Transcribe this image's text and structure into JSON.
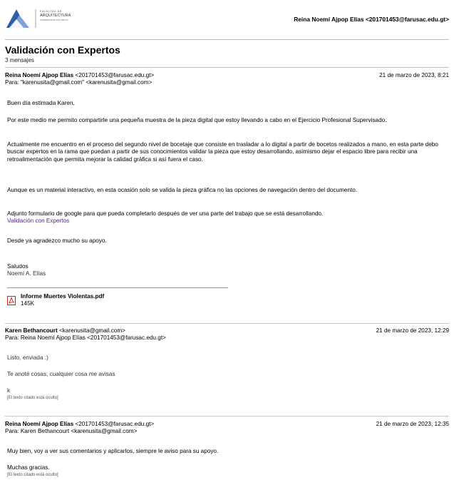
{
  "header": {
    "logo_line1": "FACULTAD DE",
    "logo_line2": "ARQUITECTURA",
    "logo_line3": "UNIVERSIDAD DE SAN CARLOS",
    "user": "Reina Noemí Ajpop Elías <201701453@farusac.edu.gt>"
  },
  "thread": {
    "subject": "Validación con Expertos",
    "count": "3 mensajes"
  },
  "messages": [
    {
      "sender_name": "Reina Noemí Ajpop Elías",
      "sender_email": "<201701453@farusac.edu.gt>",
      "to": "Para: \"karenusita@gmail.com\" <karenusita@gmail.com>",
      "date": "21 de marzo de 2023, 8:21",
      "paragraphs": [
        "Buen día estimada Karen,",
        "Por este medio me permito compartirle una pequeña muestra de la pieza digital que estoy llevando a cabo en el Ejercicio Profesional Supervisado.",
        "Actualmente me encuentro en el proceso del segundo nivel de bocetaje que consiste en trasladar a lo digital a partir de bocetos realizados a mano, en esta parte debo buscar expertos en la rama que puedan a partir de sus conocimientos validar la pieza que estoy desarrollando, asimismo dejar el espacio libre para recibir una retroalimentación que permita mejorar la calidad gráfica si así fuera el caso.",
        "Aunque es un material interactivo, en esta ocasión solo se valida la pieza gráfica no las opciones de navegación dentro del documento.",
        "Adjunto formulario de google para que pueda completarlo después de ver una parte del trabajo que se está desarrollando.",
        "Desde ya agradezco mucho su apoyo.",
        "Saludos",
        "Noemí A. Elías"
      ],
      "link": "Validación con Expertos",
      "attachment": {
        "name": "Informe Muertes Violentas.pdf",
        "size": "145K",
        "icon": "pdf-icon"
      }
    },
    {
      "sender_name": "Karen Bethancourt",
      "sender_email": "<karenusita@gmail.com>",
      "to": "Para: Reina Noemí Ajpop Elías <201701453@farusac.edu.gt>",
      "date": "21 de marzo de 2023, 12:29",
      "paragraphs": [
        "Listo, enviada :)",
        "Te anoté cosas, cualquier cosa me avisas",
        "k"
      ],
      "quoted": "[El texto citado está oculto]"
    },
    {
      "sender_name": "Reina Noemí Ajpop Elías",
      "sender_email": "<201701453@farusac.edu.gt>",
      "to": "Para: Karen Bethancourt <karenusita@gmail.com>",
      "date": "21 de marzo de 2023, 12:35",
      "paragraphs": [
        "Muy bien, voy a ver sus comentarios y aplicarlos, siempre le aviso para su apoyo.",
        "Muchas gracias."
      ],
      "quoted": "[El texto citado está oculto]"
    }
  ],
  "colors": {
    "link": "#551a8b",
    "logo_blue": "#2c5fa8",
    "pdf_red": "#cc2020"
  }
}
